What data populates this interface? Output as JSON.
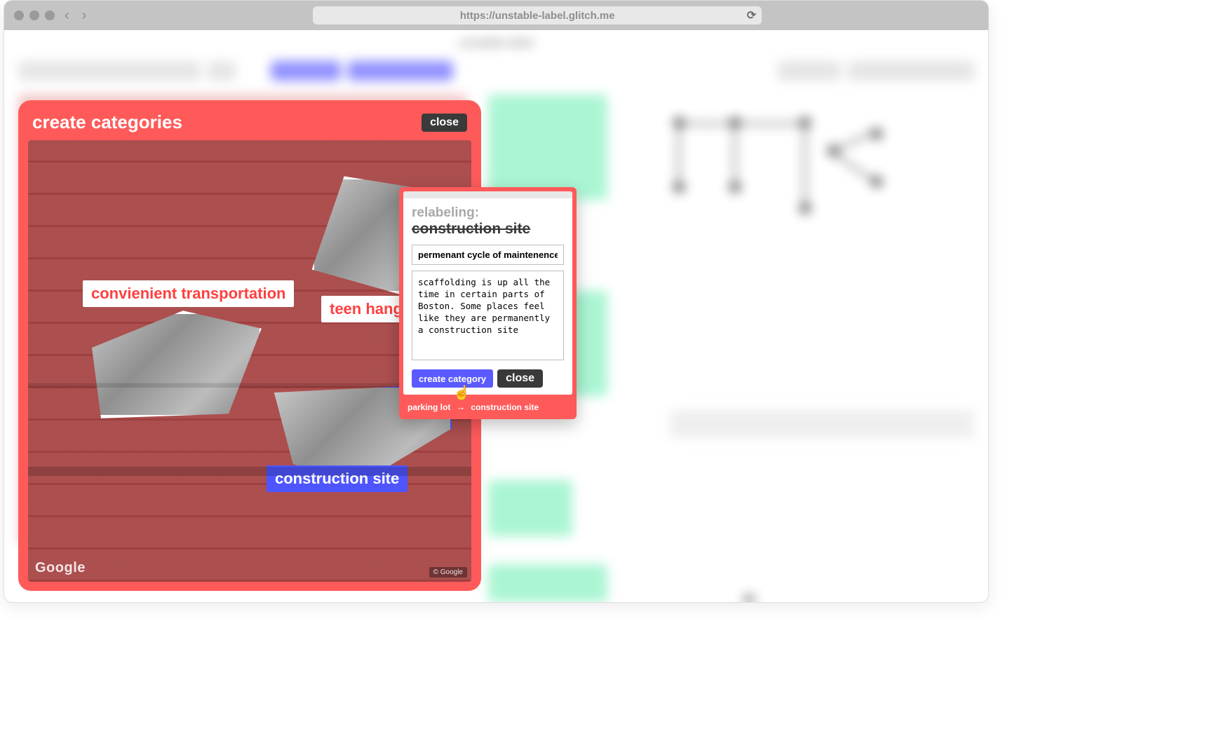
{
  "browser": {
    "url": "https://unstable-label.glitch.me",
    "back_icon": "‹",
    "forward_icon": "›",
    "reload_icon": "⟳"
  },
  "app": {
    "blurred_title": "unstable label",
    "toolbar": {
      "buttons_hint": "creating data from · decoded square ·",
      "right_label": "all categories"
    }
  },
  "modal": {
    "title": "create categories",
    "close_label": "close",
    "labels": {
      "t1": "convienient transportation",
      "t2": "teen hangout s",
      "t3": "construction site"
    },
    "google_logo": "Google",
    "google_credit": "© Google"
  },
  "relabel": {
    "prefix": "relabeling:",
    "old_label": "construction site",
    "input_value": "permenant cycle of maintenence",
    "textarea_value": "scaffolding is up all the time in certain parts of Boston. Some places feel like they are permanently a construction site",
    "create_btn": "create category",
    "close_btn": "close",
    "footer_from": "parking lot",
    "footer_arrow": "→",
    "footer_to": "construction site"
  },
  "colors": {
    "accent_red": "#ff5a5a",
    "accent_blue": "#5a5aff",
    "polygon_blue": "#4e55ff"
  }
}
